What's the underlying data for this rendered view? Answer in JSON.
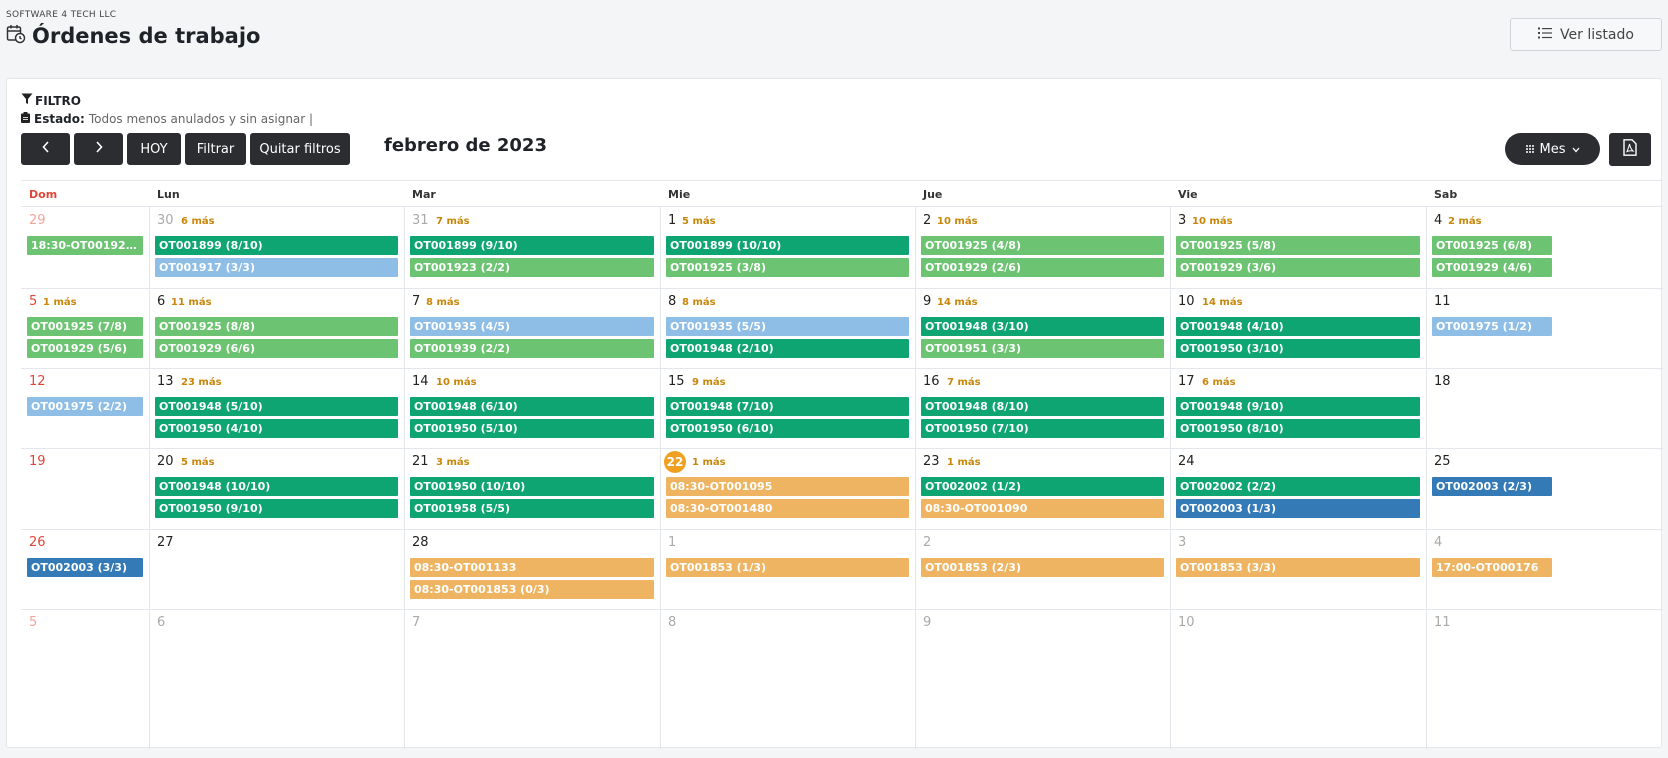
{
  "header": {
    "company": "SOFTWARE 4 TECH LLC",
    "title": "Órdenes de trabajo",
    "ver_listado_label": "Ver listado"
  },
  "filter": {
    "title": "FILTRO",
    "estado_label": "Estado:",
    "estado_value": "Todos menos anulados y sin asignar |"
  },
  "toolbar": {
    "prev_label": "‹",
    "next_label": "›",
    "hoy_label": "HOY",
    "filtrar_label": "Filtrar",
    "quitar_label": "Quitar filtros",
    "month_title": "febrero de 2023",
    "view_label": "Mes",
    "pdf_icon": "pdf-icon"
  },
  "colors": {
    "dark_green": "#0ea572",
    "light_green": "#6cc472",
    "light_blue": "#8ebde6",
    "dark_blue": "#337ab7",
    "orange": "#eeb462"
  },
  "calendar": {
    "weekdays": [
      "Dom",
      "Lun",
      "Mar",
      "Mie",
      "Jue",
      "Vie",
      "Sab"
    ],
    "weeks": [
      [
        {
          "day": "29",
          "other": true,
          "more": "",
          "events": [
            {
              "label": "18:30-OT001925 (0...",
              "color": "light_green"
            }
          ]
        },
        {
          "day": "30",
          "other": true,
          "more": "6 más",
          "events": [
            {
              "label": "OT001899 (8/10)",
              "color": "dark_green"
            },
            {
              "label": "OT001917 (3/3)",
              "color": "light_blue"
            }
          ]
        },
        {
          "day": "31",
          "other": true,
          "more": "7 más",
          "events": [
            {
              "label": "OT001899 (9/10)",
              "color": "dark_green"
            },
            {
              "label": "OT001923 (2/2)",
              "color": "light_green"
            }
          ]
        },
        {
          "day": "1",
          "more": "5 más",
          "events": [
            {
              "label": "OT001899 (10/10)",
              "color": "dark_green"
            },
            {
              "label": "OT001925 (3/8)",
              "color": "light_green"
            }
          ]
        },
        {
          "day": "2",
          "more": "10 más",
          "events": [
            {
              "label": "OT001925 (4/8)",
              "color": "light_green"
            },
            {
              "label": "OT001929 (2/6)",
              "color": "light_green"
            }
          ]
        },
        {
          "day": "3",
          "more": "10 más",
          "events": [
            {
              "label": "OT001925 (5/8)",
              "color": "light_green"
            },
            {
              "label": "OT001929 (3/6)",
              "color": "light_green"
            }
          ]
        },
        {
          "day": "4",
          "more": "2 más",
          "events": [
            {
              "label": "OT001925 (6/8)",
              "color": "light_green"
            },
            {
              "label": "OT001929 (4/6)",
              "color": "light_green"
            }
          ]
        }
      ],
      [
        {
          "day": "5",
          "more": "1 más",
          "events": [
            {
              "label": "OT001925 (7/8)",
              "color": "light_green"
            },
            {
              "label": "OT001929 (5/6)",
              "color": "light_green"
            }
          ]
        },
        {
          "day": "6",
          "more": "11 más",
          "events": [
            {
              "label": "OT001925 (8/8)",
              "color": "light_green"
            },
            {
              "label": "OT001929 (6/6)",
              "color": "light_green"
            }
          ]
        },
        {
          "day": "7",
          "more": "8 más",
          "events": [
            {
              "label": "OT001935 (4/5)",
              "color": "light_blue"
            },
            {
              "label": "OT001939 (2/2)",
              "color": "light_green"
            }
          ]
        },
        {
          "day": "8",
          "more": "8 más",
          "events": [
            {
              "label": "OT001935 (5/5)",
              "color": "light_blue"
            },
            {
              "label": "OT001948 (2/10)",
              "color": "dark_green"
            }
          ]
        },
        {
          "day": "9",
          "more": "14 más",
          "events": [
            {
              "label": "OT001948 (3/10)",
              "color": "dark_green"
            },
            {
              "label": "OT001951 (3/3)",
              "color": "light_green"
            }
          ]
        },
        {
          "day": "10",
          "more": "14 más",
          "events": [
            {
              "label": "OT001948 (4/10)",
              "color": "dark_green"
            },
            {
              "label": "OT001950 (3/10)",
              "color": "dark_green"
            }
          ]
        },
        {
          "day": "11",
          "more": "",
          "events": [
            {
              "label": "OT001975 (1/2)",
              "color": "light_blue"
            }
          ]
        }
      ],
      [
        {
          "day": "12",
          "more": "",
          "events": [
            {
              "label": "OT001975 (2/2)",
              "color": "light_blue"
            }
          ]
        },
        {
          "day": "13",
          "more": "23 más",
          "events": [
            {
              "label": "OT001948 (5/10)",
              "color": "dark_green"
            },
            {
              "label": "OT001950 (4/10)",
              "color": "dark_green"
            }
          ]
        },
        {
          "day": "14",
          "more": "10 más",
          "events": [
            {
              "label": "OT001948 (6/10)",
              "color": "dark_green"
            },
            {
              "label": "OT001950 (5/10)",
              "color": "dark_green"
            }
          ]
        },
        {
          "day": "15",
          "more": "9 más",
          "events": [
            {
              "label": "OT001948 (7/10)",
              "color": "dark_green"
            },
            {
              "label": "OT001950 (6/10)",
              "color": "dark_green"
            }
          ]
        },
        {
          "day": "16",
          "more": "7 más",
          "events": [
            {
              "label": "OT001948 (8/10)",
              "color": "dark_green"
            },
            {
              "label": "OT001950 (7/10)",
              "color": "dark_green"
            }
          ]
        },
        {
          "day": "17",
          "more": "6 más",
          "events": [
            {
              "label": "OT001948 (9/10)",
              "color": "dark_green"
            },
            {
              "label": "OT001950 (8/10)",
              "color": "dark_green"
            }
          ]
        },
        {
          "day": "18",
          "more": "",
          "events": []
        }
      ],
      [
        {
          "day": "19",
          "more": "",
          "events": []
        },
        {
          "day": "20",
          "more": "5 más",
          "events": [
            {
              "label": "OT001948 (10/10)",
              "color": "dark_green"
            },
            {
              "label": "OT001950 (9/10)",
              "color": "dark_green"
            }
          ]
        },
        {
          "day": "21",
          "more": "3 más",
          "events": [
            {
              "label": "OT001950 (10/10)",
              "color": "dark_green"
            },
            {
              "label": "OT001958 (5/5)",
              "color": "dark_green"
            }
          ]
        },
        {
          "day": "22",
          "today": true,
          "more": "1 más",
          "events": [
            {
              "label": "08:30-OT001095",
              "color": "orange"
            },
            {
              "label": "08:30-OT001480",
              "color": "orange"
            }
          ]
        },
        {
          "day": "23",
          "more": "1 más",
          "events": [
            {
              "label": "OT002002 (1/2)",
              "color": "dark_green"
            },
            {
              "label": "08:30-OT001090",
              "color": "orange"
            }
          ]
        },
        {
          "day": "24",
          "more": "",
          "events": [
            {
              "label": "OT002002 (2/2)",
              "color": "dark_green"
            },
            {
              "label": "OT002003 (1/3)",
              "color": "dark_blue"
            }
          ]
        },
        {
          "day": "25",
          "more": "",
          "events": [
            {
              "label": "OT002003 (2/3)",
              "color": "dark_blue"
            }
          ]
        }
      ],
      [
        {
          "day": "26",
          "more": "",
          "events": [
            {
              "label": "OT002003 (3/3)",
              "color": "dark_blue"
            }
          ]
        },
        {
          "day": "27",
          "more": "",
          "events": []
        },
        {
          "day": "28",
          "more": "",
          "events": [
            {
              "label": "08:30-OT001133",
              "color": "orange"
            },
            {
              "label": "08:30-OT001853 (0/3)",
              "color": "orange"
            }
          ]
        },
        {
          "day": "1",
          "other": true,
          "more": "",
          "events": [
            {
              "label": "OT001853 (1/3)",
              "color": "orange"
            }
          ]
        },
        {
          "day": "2",
          "other": true,
          "more": "",
          "events": [
            {
              "label": "OT001853 (2/3)",
              "color": "orange"
            }
          ]
        },
        {
          "day": "3",
          "other": true,
          "more": "",
          "events": [
            {
              "label": "OT001853 (3/3)",
              "color": "orange"
            }
          ]
        },
        {
          "day": "4",
          "other": true,
          "more": "",
          "events": [
            {
              "label": "17:00-OT000176",
              "color": "orange"
            }
          ]
        }
      ],
      [
        {
          "day": "5",
          "other": true,
          "more": "",
          "events": []
        },
        {
          "day": "6",
          "other": true,
          "more": "",
          "events": []
        },
        {
          "day": "7",
          "other": true,
          "more": "",
          "events": []
        },
        {
          "day": "8",
          "other": true,
          "more": "",
          "events": []
        },
        {
          "day": "9",
          "other": true,
          "more": "",
          "events": []
        },
        {
          "day": "10",
          "other": true,
          "more": "",
          "events": []
        },
        {
          "day": "11",
          "other": true,
          "more": "",
          "events": []
        }
      ]
    ]
  }
}
